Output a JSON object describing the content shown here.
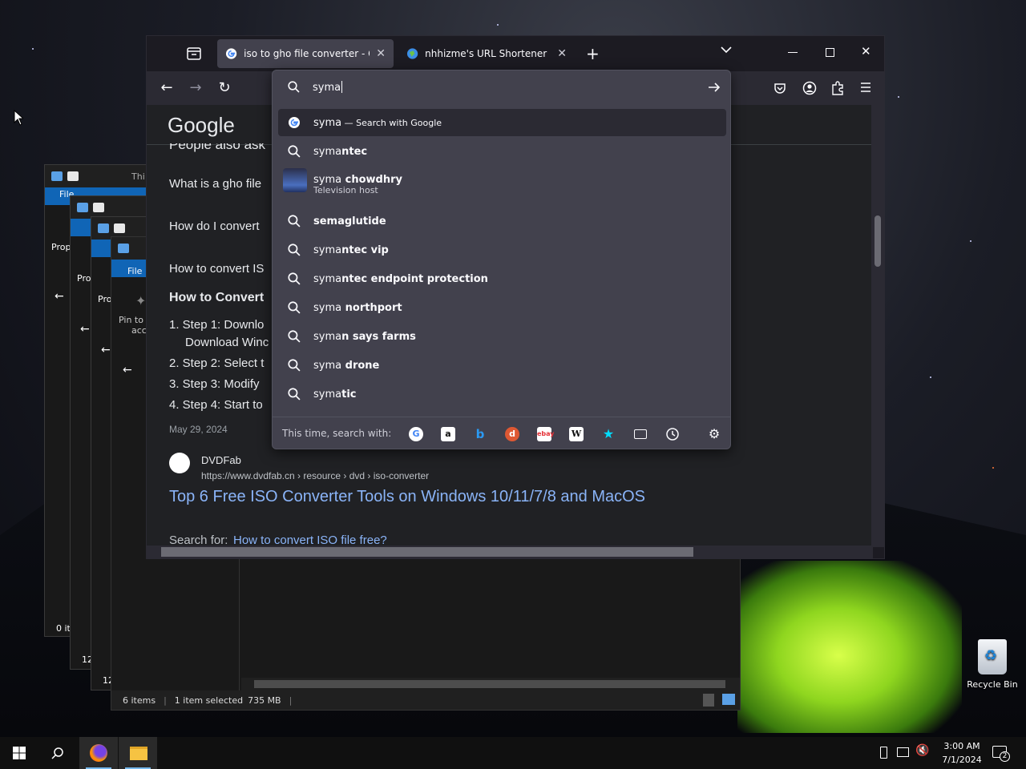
{
  "browser": {
    "tabs": [
      {
        "title": "iso to gho file converter - Google Search"
      },
      {
        "title": "nhhizme's URL Shortener"
      }
    ]
  },
  "urlbar": {
    "query": "syma",
    "suggestions": [
      {
        "typed": "syma",
        "rest": "",
        "desc": " — Search with Google"
      },
      {
        "typed": "syma",
        "rest": "ntec"
      },
      {
        "typed": "syma",
        "rest": " chowdhry",
        "sub": "Television host"
      },
      {
        "typed": "",
        "rest": "semaglutide"
      },
      {
        "typed": "syma",
        "rest": "ntec vip"
      },
      {
        "typed": "syma",
        "rest": "ntec endpoint protection"
      },
      {
        "typed": "syma",
        "rest": " northport"
      },
      {
        "typed": "syma",
        "rest": "n says farms"
      },
      {
        "typed": "syma",
        "rest": " drone"
      },
      {
        "typed": "syma",
        "rest": "tic"
      }
    ],
    "oneoff_label": "This time, search with:"
  },
  "page": {
    "logo": "Google",
    "people_also": "People also ask",
    "items": [
      "What is a gho file",
      "How do I convert",
      "How to convert IS"
    ],
    "heading": "How to Convert",
    "steps": [
      "1. Step 1: Downlo",
      "Download Winc",
      "2. Step 2: Select t",
      "3. Step 3: Modify",
      "4. Step 4: Start to"
    ],
    "date": "May 29, 2024",
    "result_site": "DVDFab",
    "result_url": "https://www.dvdfab.cn › resource › dvd › iso-converter",
    "result_title": "Top 6 Free ISO Converter Tools on Windows 10/11/7/8 and MacOS",
    "search_for_label": "Search for:",
    "search_for_link": "How to convert ISO file free?"
  },
  "explorer": {
    "status_items": "6 items",
    "status_selected": "1 item selected",
    "status_size": "735 MB",
    "ribbon_file": "File",
    "pin_label": "Pin to",
    "pin_label2": "acce",
    "prop_label": "Prop",
    "prop_label2": "Pro",
    "count_label": "0 it",
    "count_12": "12",
    "this_label": "Thi"
  },
  "desktop": {
    "recycle_bin": "Recycle Bin"
  },
  "taskbar": {
    "time": "3:00 AM",
    "date": "7/1/2024",
    "notif_count": "2"
  },
  "colors": {
    "accent": "#76b9ed",
    "link": "#8ab4f8",
    "popup_bg": "#42414d",
    "explorer_ribbon": "#1065b6"
  }
}
